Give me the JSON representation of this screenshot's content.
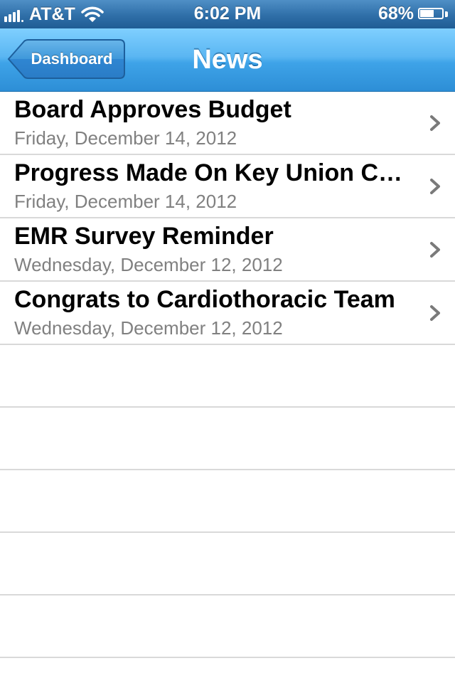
{
  "status_bar": {
    "carrier": "AT&T",
    "time": "6:02 PM",
    "battery_percent": "68%",
    "battery_level": 0.68,
    "signal_icon": "signal-bars-icon",
    "wifi_icon": "wifi-icon",
    "battery_icon": "battery-icon"
  },
  "nav": {
    "back_label": "Dashboard",
    "title": "News",
    "colors": {
      "nav_top": "#7fcfff",
      "nav_bottom": "#2d8ed6",
      "back_button": "#2f86d2"
    }
  },
  "news": [
    {
      "title": "Board Approves Budget",
      "date": "Friday, December 14, 2012"
    },
    {
      "title": "Progress Made On Key Union Contract Negotiations",
      "date": "Friday, December 14, 2012"
    },
    {
      "title": "EMR Survey Reminder",
      "date": "Wednesday, December 12, 2012"
    },
    {
      "title": "Congrats to Cardiothoracic Team",
      "date": "Wednesday, December 12, 2012"
    }
  ],
  "list_colors": {
    "title": "#000000",
    "date": "#808080",
    "separator": "#d9d9d9",
    "chevron": "#7a7a7a"
  }
}
